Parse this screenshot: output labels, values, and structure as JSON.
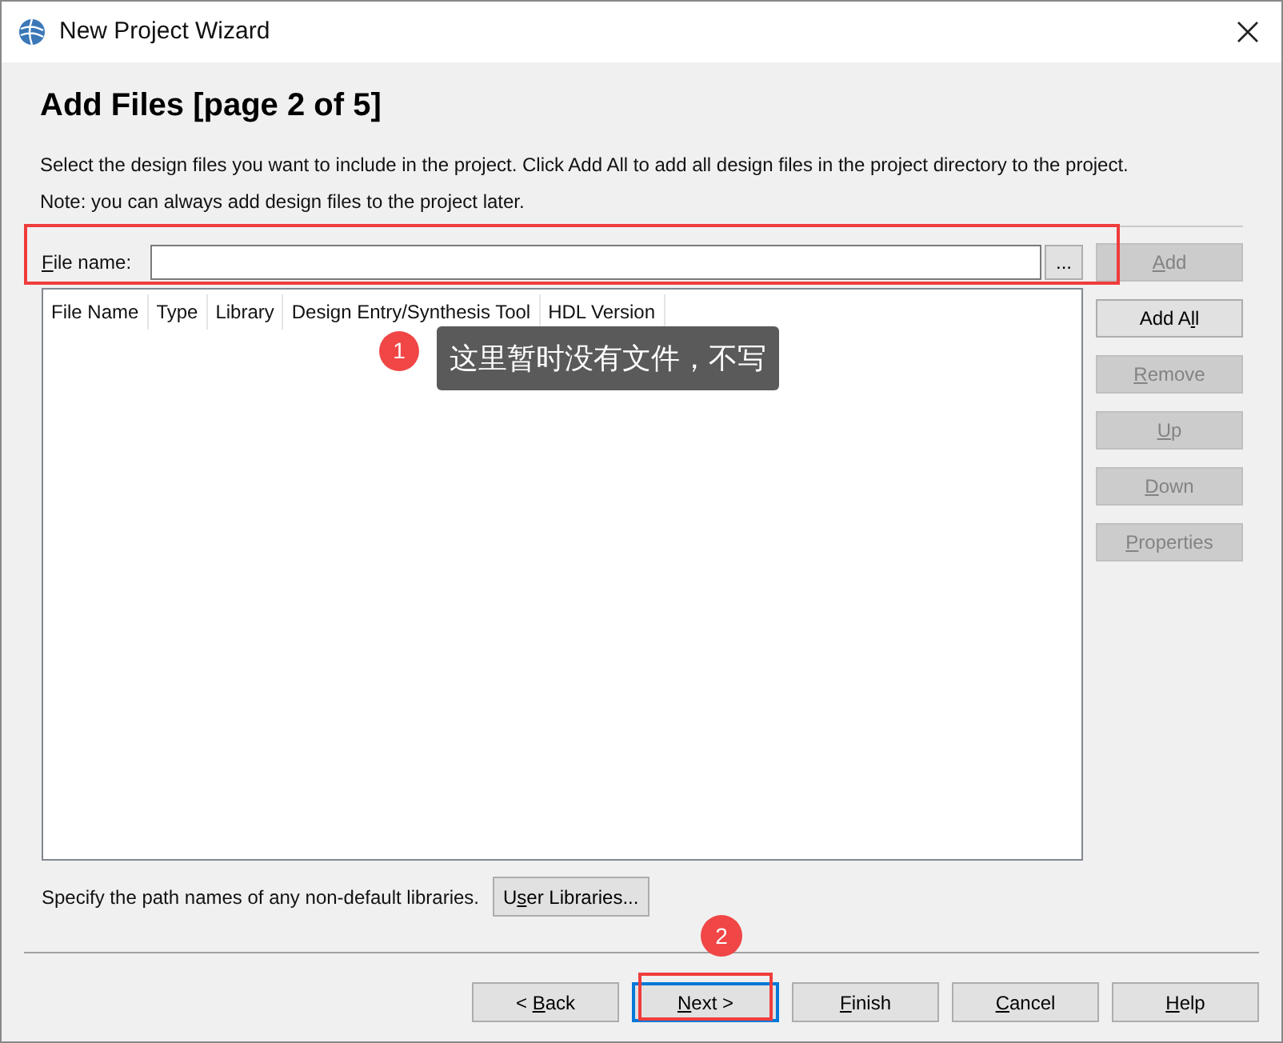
{
  "window": {
    "title": "New Project Wizard"
  },
  "heading": "Add Files [page 2 of 5]",
  "description": [
    "Select the design files you want to include in the project. Click Add All to add all design files in the project directory to the project.",
    "Note: you can always add design files to the project later."
  ],
  "file_name": {
    "label": {
      "key": "F",
      "post": "ile name:"
    },
    "browse": "..."
  },
  "table": {
    "columns": [
      "File Name",
      "Type",
      "Library",
      "Design Entry/Synthesis Tool",
      "HDL Version"
    ]
  },
  "side_buttons": [
    {
      "key": "A",
      "post": "dd",
      "disabled": true
    },
    {
      "pre": "Add A",
      "key": "l",
      "post": "l",
      "disabled": false
    },
    {
      "key": "R",
      "post": "emove",
      "disabled": true
    },
    {
      "key": "U",
      "post": "p",
      "disabled": true
    },
    {
      "key": "D",
      "post": "own",
      "disabled": true
    },
    {
      "key": "P",
      "post": "roperties",
      "disabled": true
    }
  ],
  "libraries": {
    "text": "Specify the path names of any non-default libraries.",
    "button": {
      "pre": "U",
      "key": "s",
      "post": "er Libraries..."
    }
  },
  "footer_buttons": [
    {
      "pre": "< ",
      "key": "B",
      "post": "ack",
      "focused": false
    },
    {
      "key": "N",
      "post": "ext >",
      "focused": true
    },
    {
      "key": "F",
      "post": "inish",
      "focused": false
    },
    {
      "key": "C",
      "post": "ancel",
      "focused": false
    },
    {
      "key": "H",
      "post": "elp",
      "focused": false
    }
  ],
  "annotations": [
    {
      "number": "1",
      "text": "这里暂时没有文件，不写"
    },
    {
      "number": "2"
    }
  ]
}
